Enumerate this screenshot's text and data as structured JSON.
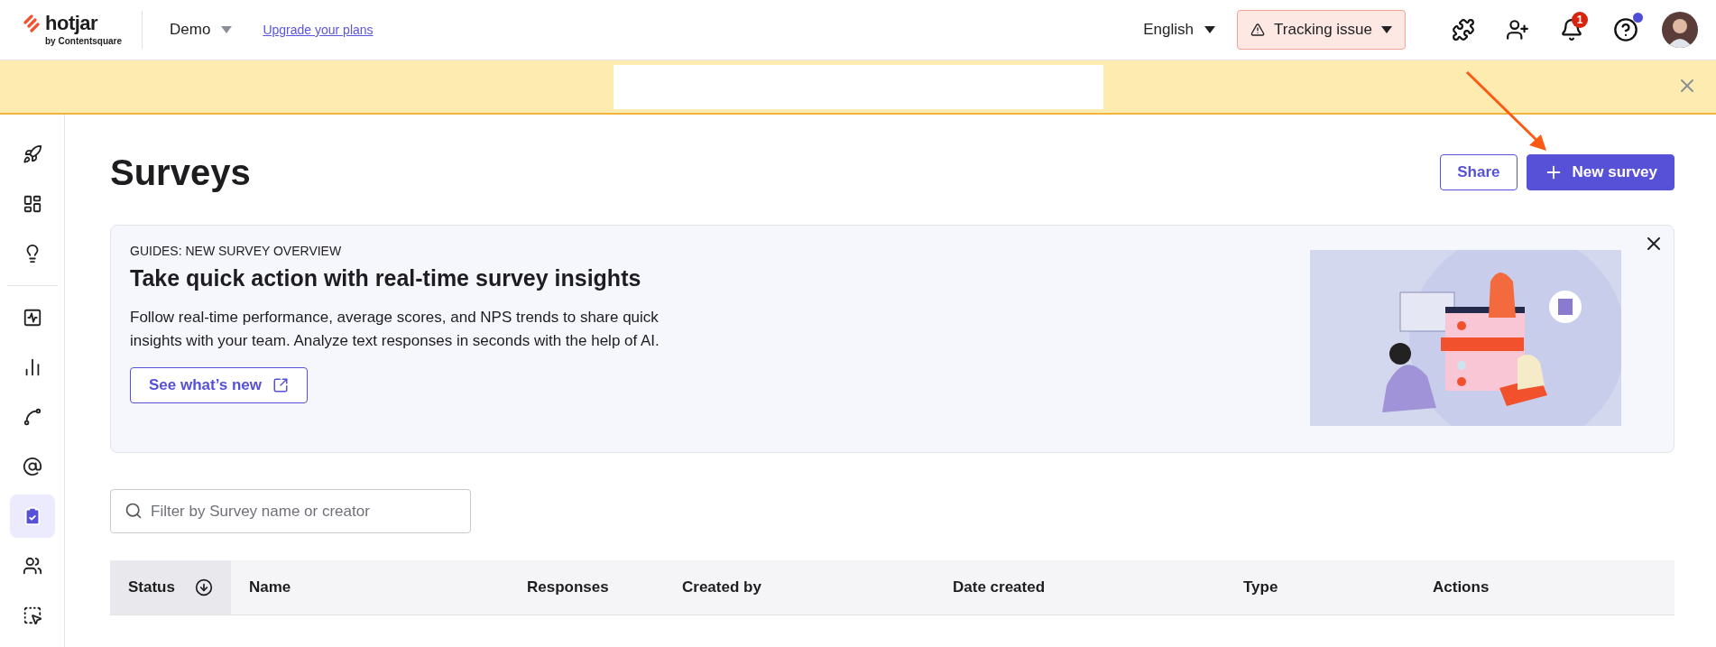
{
  "topbar": {
    "logo": {
      "name": "hotjar",
      "tagline": "by Contentsquare"
    },
    "project": "Demo",
    "upgrade_link": "Upgrade your plans",
    "language": "English",
    "tracking_button": "Tracking issue",
    "notifications": {
      "count": "1"
    }
  },
  "sidebar": {
    "groups": [
      [
        {
          "selected": false
        },
        {
          "selected": false
        },
        {
          "selected": false
        }
      ],
      [
        {
          "selected": false
        },
        {
          "selected": false
        },
        {
          "selected": false
        },
        {
          "selected": false
        },
        {
          "selected": true
        },
        {
          "selected": false
        },
        {
          "selected": false
        }
      ]
    ]
  },
  "page": {
    "title": "Surveys",
    "buttons": [
      {
        "kind": "secondary",
        "label": "Share"
      },
      {
        "kind": "primary",
        "label": "New survey"
      }
    ]
  },
  "guide": {
    "eyebrow": "GUIDES: NEW SURVEY OVERVIEW",
    "heading": "Take quick action with real-time survey insights",
    "body": "Follow real-time performance, average scores, and NPS trends to share quick insights with your team. Analyze text responses in seconds with the help of AI.",
    "link_button": "See what’s new"
  },
  "filter": {
    "placeholder": "Filter by Survey name or creator"
  },
  "table": {
    "columns": [
      {
        "label": "Status",
        "sorted": true
      },
      {
        "label": "Name",
        "sorted": false
      },
      {
        "label": "Responses",
        "sorted": false
      },
      {
        "label": "Created by",
        "sorted": false
      },
      {
        "label": "Date created",
        "sorted": false
      },
      {
        "label": "Type",
        "sorted": false
      },
      {
        "label": "Actions",
        "sorted": false
      }
    ]
  }
}
